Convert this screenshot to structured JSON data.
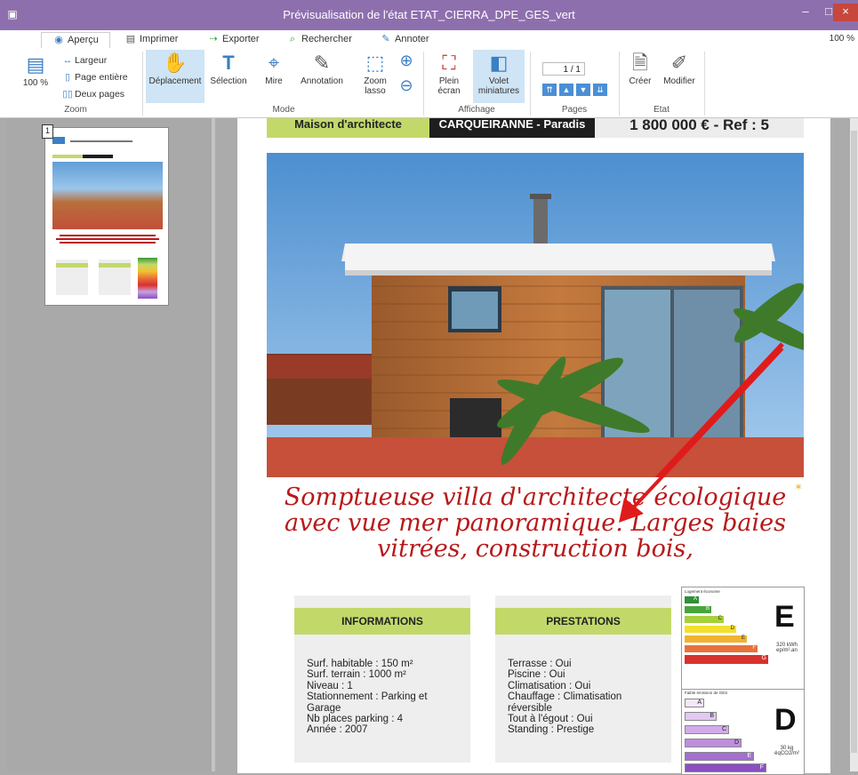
{
  "window": {
    "title": "Prévisualisation de l'état ETAT_CIERRA_DPE_GES_vert",
    "controls": {
      "minimize": "–",
      "maximize": "□",
      "close": "×"
    }
  },
  "tabs": [
    {
      "label": "Aperçu",
      "icon": "eye-icon"
    },
    {
      "label": "Imprimer",
      "icon": "printer-icon"
    },
    {
      "label": "Exporter",
      "icon": "export-icon"
    },
    {
      "label": "Rechercher",
      "icon": "search-icon"
    },
    {
      "label": "Annoter",
      "icon": "pen-icon"
    }
  ],
  "zoom_level": "100 %",
  "ribbon": {
    "zoom": {
      "label": "Zoom",
      "percent": "100 %",
      "largeur": "Largeur",
      "page_entiere": "Page entière",
      "deux_pages": "Deux pages"
    },
    "mode": {
      "label": "Mode",
      "deplacement": "Déplacement",
      "selection": "Sélection",
      "mire": "Mire",
      "annotation": "Annotation",
      "zoom_lasso": "Zoom lasso"
    },
    "affichage": {
      "label": "Affichage",
      "plein_ecran": "Plein écran",
      "volet_miniatures": "Volet miniatures"
    },
    "pages": {
      "label": "Pages",
      "current": "1",
      "total": "/ 1"
    },
    "etat": {
      "label": "Etat",
      "creer": "Créer",
      "modifier": "Modifier"
    }
  },
  "thumbnail": {
    "page_number": "1"
  },
  "document": {
    "header_left": "Maison d'architecte",
    "header_mid": "CARQUEIRANNE - Paradis",
    "header_right": "1 800 000 € - Ref : 5",
    "headline": "Somptueuse villa d'architecte écologique avec vue mer panoramique. Larges baies vitrées, construction bois,",
    "informations": {
      "title": "INFORMATIONS",
      "lines": [
        "Surf. habitable : 150 m²",
        "Surf. terrain : 1000 m²",
        "Niveau : 1",
        "Stationnement : Parking et",
        "Garage",
        "Nb places parking : 4",
        "Année : 2007"
      ]
    },
    "prestations": {
      "title": "PRESTATIONS",
      "lines": [
        "Terrasse : Oui",
        "Piscine : Oui",
        "Climatisation : Oui",
        "Chauffage : Climatisation",
        "réversible",
        "Tout à l'égout : Oui",
        "Standing : Prestige"
      ]
    },
    "dpe": {
      "heading": "Logement économe",
      "grade": "E",
      "value": "320 kWh ep/m².an",
      "bands": [
        "A",
        "B",
        "C",
        "D",
        "E",
        "F",
        "G"
      ]
    },
    "ges": {
      "heading": "Faible émission de GES",
      "grade": "D",
      "value": "30 kg éqCO2/m²",
      "bands": [
        "A",
        "B",
        "C",
        "D",
        "E",
        "F"
      ]
    }
  },
  "colors": {
    "titlebar": "#8e6fae",
    "accent_green": "#c2d96a",
    "headline_red": "#b8191a",
    "ribbon_selected": "#cfe4f5"
  }
}
